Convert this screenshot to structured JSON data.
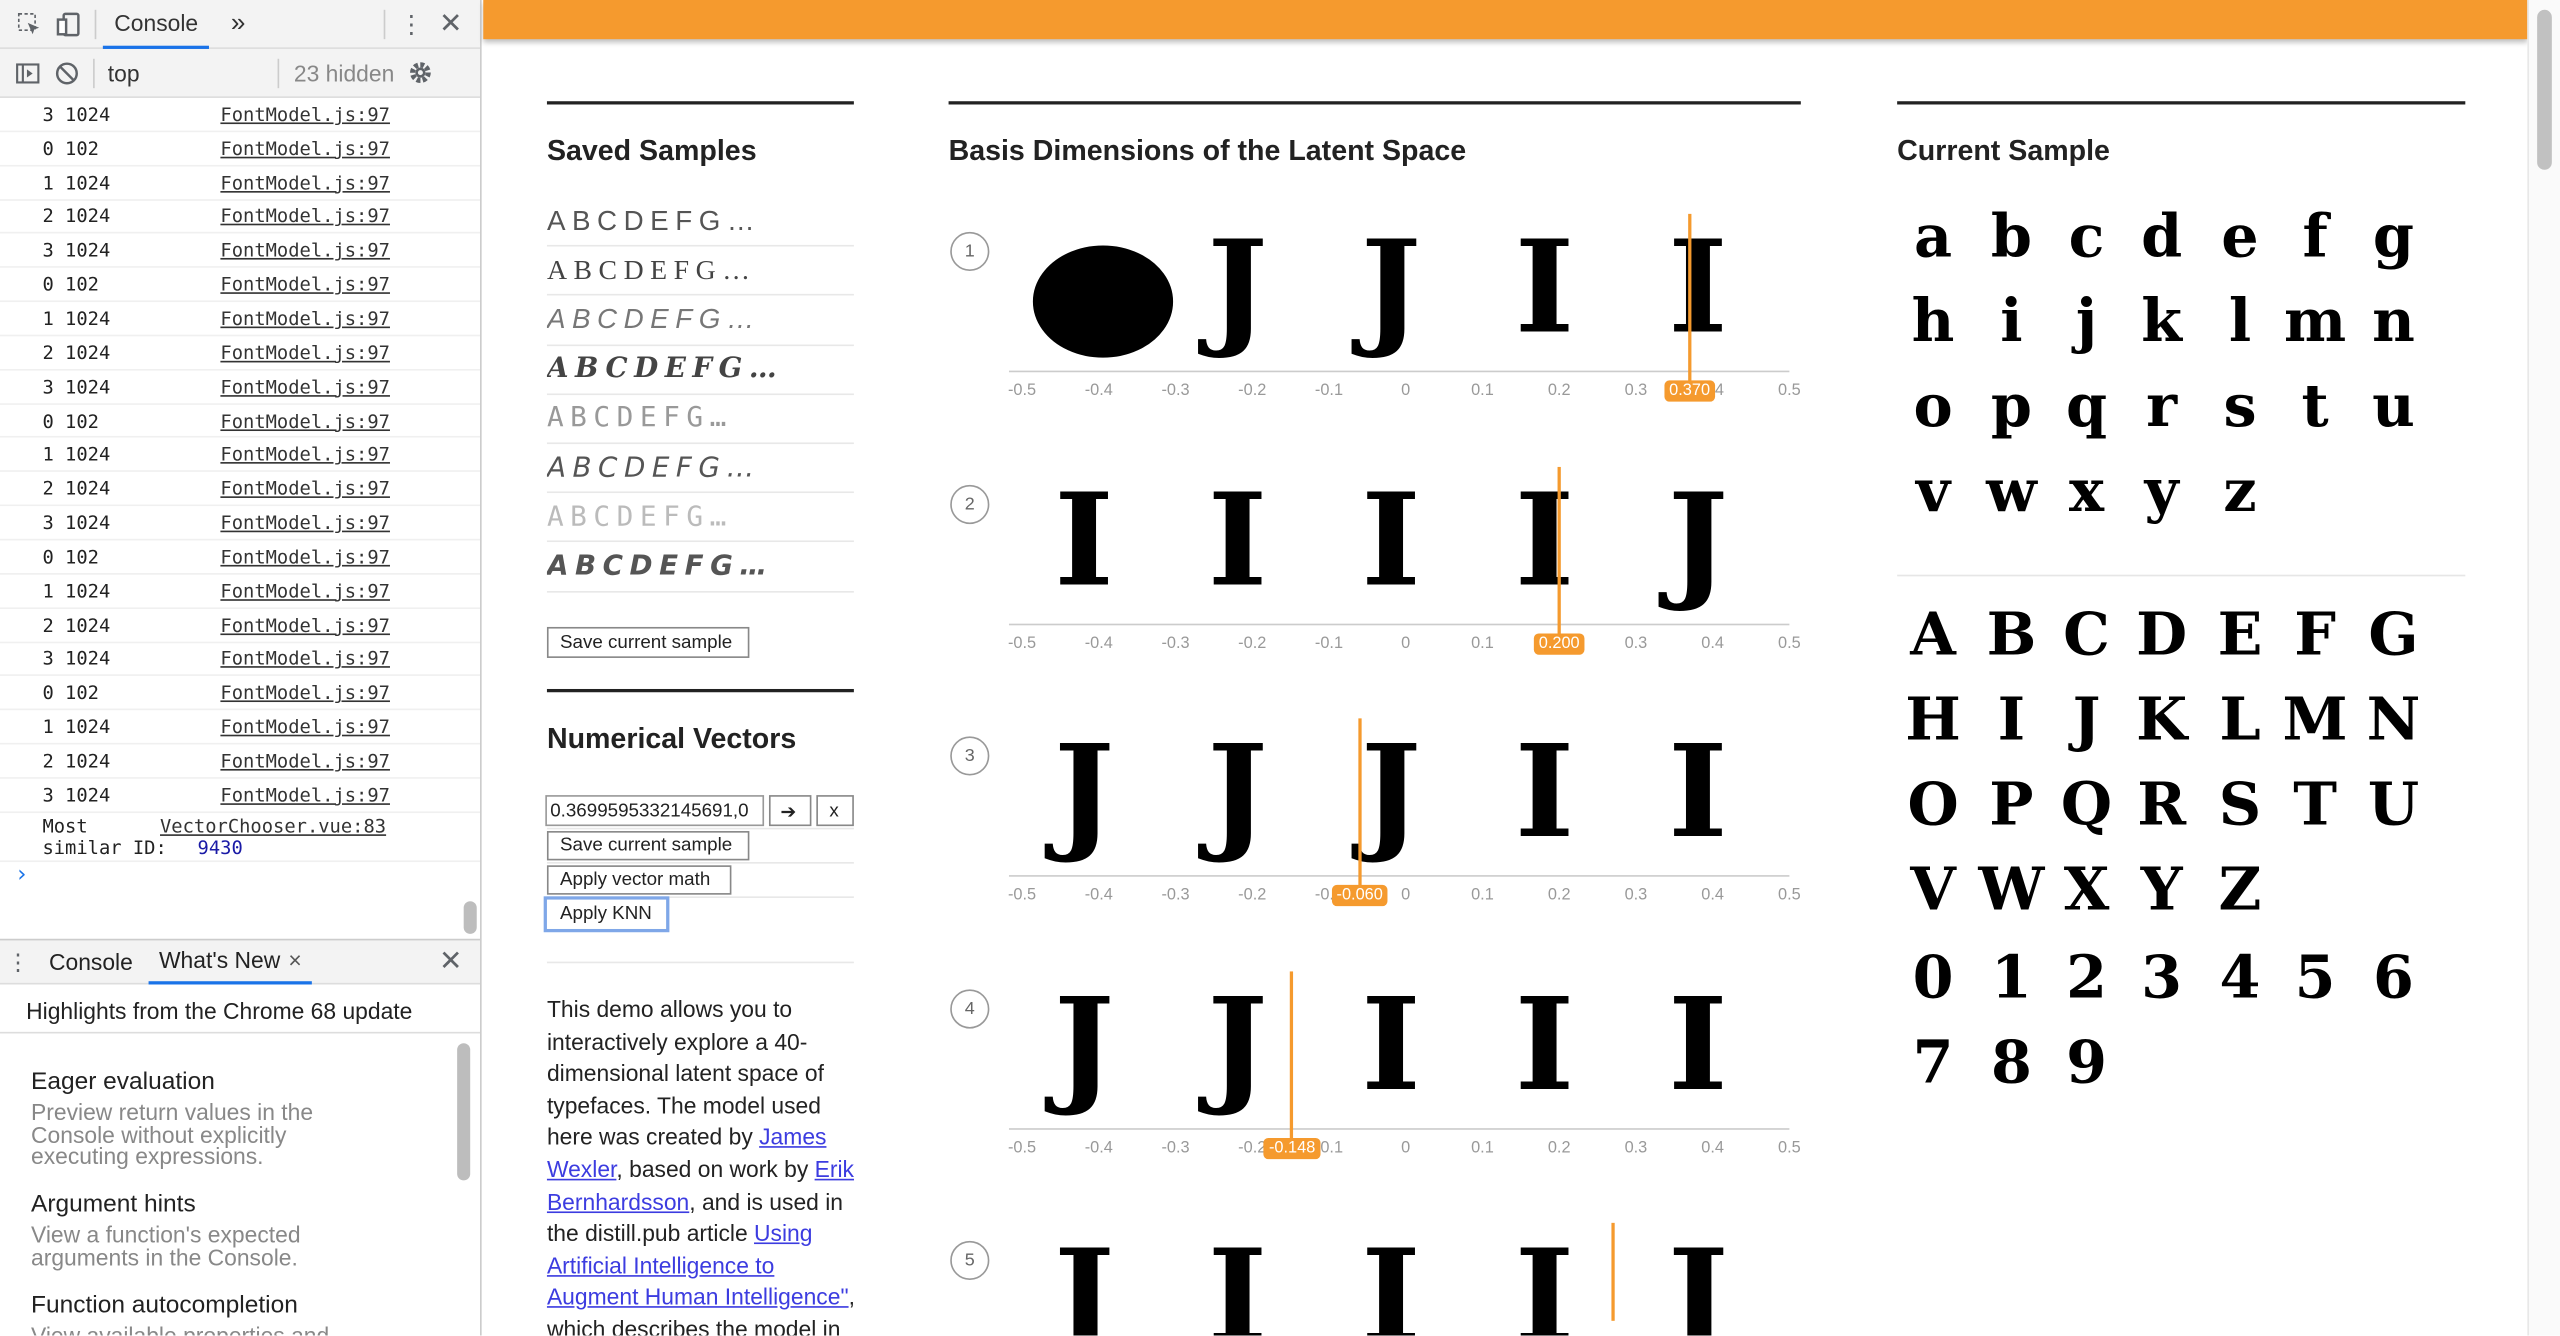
{
  "devtools": {
    "toolbar": {
      "inspect_icon": "inspect-icon",
      "device_icon": "device-icon",
      "console_tab": "Console",
      "more_tabs": "»",
      "menu_icon": "⋮",
      "close": "✕"
    },
    "filterbar": {
      "context": "top",
      "hidden": "23 hidden"
    },
    "logs": [
      {
        "msg": "3 1024",
        "src": "FontModel.js:97"
      },
      {
        "msg": "0 102",
        "src": "FontModel.js:97"
      },
      {
        "msg": "1 1024",
        "src": "FontModel.js:97"
      },
      {
        "msg": "2 1024",
        "src": "FontModel.js:97"
      },
      {
        "msg": "3 1024",
        "src": "FontModel.js:97"
      },
      {
        "msg": "0 102",
        "src": "FontModel.js:97"
      },
      {
        "msg": "1 1024",
        "src": "FontModel.js:97"
      },
      {
        "msg": "2 1024",
        "src": "FontModel.js:97"
      },
      {
        "msg": "3 1024",
        "src": "FontModel.js:97"
      },
      {
        "msg": "0 102",
        "src": "FontModel.js:97"
      },
      {
        "msg": "1 1024",
        "src": "FontModel.js:97"
      },
      {
        "msg": "2 1024",
        "src": "FontModel.js:97"
      },
      {
        "msg": "3 1024",
        "src": "FontModel.js:97"
      },
      {
        "msg": "0 102",
        "src": "FontModel.js:97"
      },
      {
        "msg": "1 1024",
        "src": "FontModel.js:97"
      },
      {
        "msg": "2 1024",
        "src": "FontModel.js:97"
      },
      {
        "msg": "3 1024",
        "src": "FontModel.js:97"
      },
      {
        "msg": "0 102",
        "src": "FontModel.js:97"
      },
      {
        "msg": "1 1024",
        "src": "FontModel.js:97"
      },
      {
        "msg": "2 1024",
        "src": "FontModel.js:97"
      },
      {
        "msg": "3 1024",
        "src": "FontModel.js:97"
      }
    ],
    "last_log": {
      "line1": "Most",
      "line2": "similar ID:",
      "value": "9430",
      "src": "VectorChooser.vue:83"
    },
    "prompt": "›",
    "drawer": {
      "tabs": [
        "Console",
        "What's New"
      ],
      "close_tab": "×",
      "close": "✕",
      "headline": "Highlights from the Chrome 68 update",
      "items": [
        {
          "title": "Eager evaluation",
          "desc": "Preview return values in the Console without explicitly executing expressions."
        },
        {
          "title": "Argument hints",
          "desc": "View a function's expected arguments in the Console."
        },
        {
          "title": "Function autocompletion",
          "desc": "View available properties and"
        }
      ]
    }
  },
  "page": {
    "saved_samples": {
      "title": "Saved Samples",
      "rows": [
        {
          "text": "ABCDEFG…",
          "font": "Liberation Sans",
          "weight": "normal",
          "style": "normal",
          "color": "#555"
        },
        {
          "text": "ABCDEFG…",
          "font": "Liberation Serif",
          "weight": "normal",
          "style": "normal",
          "color": "#444"
        },
        {
          "text": "ABCDEFG…",
          "font": "Liberation Sans",
          "weight": "normal",
          "style": "italic",
          "color": "#777"
        },
        {
          "text": "ABCDEFG…",
          "font": "DejaVu Serif",
          "weight": "bold",
          "style": "italic",
          "color": "#444"
        },
        {
          "text": "ABCDEFG…",
          "font": "DejaVu Sans Mono",
          "weight": "normal",
          "style": "normal",
          "color": "#999"
        },
        {
          "text": "ABCDEFG…",
          "font": "DejaVu Sans",
          "weight": "normal",
          "style": "italic",
          "color": "#555"
        },
        {
          "text": "ABCDEFG…",
          "font": "DejaVu Sans Mono",
          "weight": "normal",
          "style": "normal",
          "color": "#bbb"
        },
        {
          "text": "ABCDEFG…",
          "font": "DejaVu Sans",
          "weight": "bold",
          "style": "italic",
          "color": "#555"
        }
      ],
      "save_button": "Save current sample"
    },
    "numerical_vectors": {
      "title": "Numerical Vectors",
      "input_value": "0.3699595332145691,0",
      "go_button": "➔",
      "clear_button": "x",
      "save_button": "Save current sample",
      "math_button": "Apply vector math",
      "knn_button": "Apply KNN"
    },
    "description": {
      "p1": "This demo allows you to interactively explore a 40-dimensional latent space of typefaces. The model used here was created by ",
      "link1": "James Wexler",
      "p2": ", based on work by ",
      "link2": "Erik Bernhardsson",
      "p3": ", and is used in the distill.pub article ",
      "link3": "Using Artificial Intelligence to Augment Human Intelligence\"",
      "p4": ", which describes the model in"
    },
    "basis": {
      "title": "Basis Dimensions of the Latent Space",
      "ticks": [
        "-0.5",
        "-0.4",
        "-0.3",
        "-0.2",
        "-0.1",
        "0",
        "0.1",
        "0.2",
        "0.3",
        "0.4",
        "0.5"
      ],
      "dims": [
        {
          "num": "1",
          "value": 0.37,
          "label": "0.370",
          "glyphs": [
            "●",
            "J",
            "J",
            "I",
            "I"
          ]
        },
        {
          "num": "2",
          "value": 0.2,
          "label": "0.200",
          "glyphs": [
            "I",
            "I",
            "I",
            "I",
            "J"
          ]
        },
        {
          "num": "3",
          "value": -0.06,
          "label": "-0.060",
          "glyphs": [
            "J",
            "J",
            "J",
            "I",
            "I"
          ]
        },
        {
          "num": "4",
          "value": -0.148,
          "label": "-0.148",
          "glyphs": [
            "J",
            "J",
            "I",
            "I",
            "I"
          ]
        },
        {
          "num": "5",
          "value": 0.27,
          "label": "",
          "glyphs": [
            "J",
            "I",
            "I",
            "I",
            "J"
          ]
        }
      ]
    },
    "current_sample": {
      "title": "Current Sample",
      "lowercase": [
        "a",
        "b",
        "c",
        "d",
        "e",
        "f",
        "g",
        "h",
        "i",
        "j",
        "k",
        "l",
        "m",
        "n",
        "o",
        "p",
        "q",
        "r",
        "s",
        "t",
        "u",
        "v",
        "w",
        "x",
        "y",
        "z"
      ],
      "uppercase": [
        "A",
        "B",
        "C",
        "D",
        "E",
        "F",
        "G",
        "H",
        "I",
        "J",
        "K",
        "L",
        "M",
        "N",
        "O",
        "P",
        "Q",
        "R",
        "S",
        "T",
        "U",
        "V",
        "W",
        "X",
        "Y",
        "Z"
      ],
      "digits": [
        "0",
        "1",
        "2",
        "3",
        "4",
        "5",
        "6",
        "7",
        "8",
        "9"
      ]
    }
  }
}
